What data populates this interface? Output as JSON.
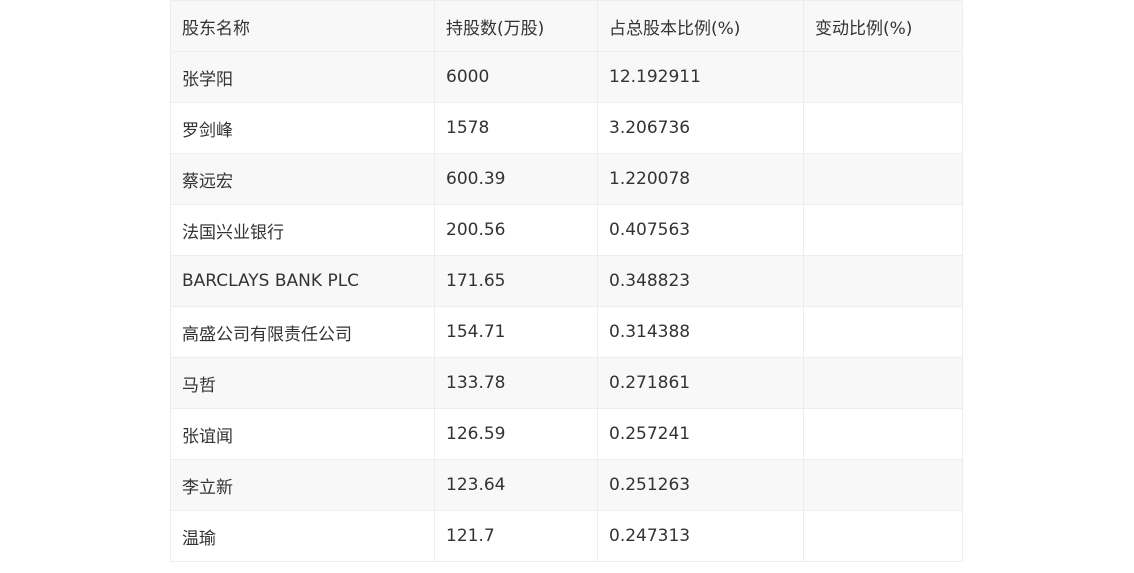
{
  "table": {
    "headers": [
      "股东名称",
      "持股数(万股)",
      "占总股本比例(%)",
      "变动比例(%)"
    ],
    "rows": [
      [
        "张学阳",
        "6000",
        "12.192911",
        ""
      ],
      [
        "罗剑峰",
        "1578",
        "3.206736",
        ""
      ],
      [
        "蔡远宏",
        "600.39",
        "1.220078",
        ""
      ],
      [
        "法国兴业银行",
        "200.56",
        "0.407563",
        ""
      ],
      [
        "BARCLAYS BANK PLC",
        "171.65",
        "0.348823",
        ""
      ],
      [
        "高盛公司有限责任公司",
        "154.71",
        "0.314388",
        ""
      ],
      [
        "马哲",
        "133.78",
        "0.271861",
        ""
      ],
      [
        "张谊闻",
        "126.59",
        "0.257241",
        ""
      ],
      [
        "李立新",
        "123.64",
        "0.251263",
        ""
      ],
      [
        "温瑜",
        "121.7",
        "0.247313",
        ""
      ]
    ]
  }
}
